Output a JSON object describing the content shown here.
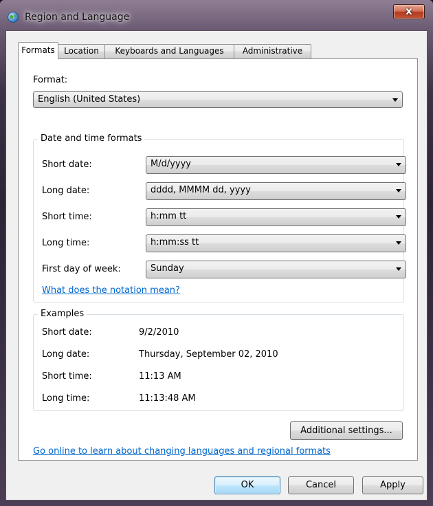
{
  "window": {
    "title": "Region and Language",
    "close_glyph": "x",
    "icon": "globe-icon"
  },
  "tabs": [
    {
      "label": "Formats",
      "active": true
    },
    {
      "label": "Location",
      "active": false
    },
    {
      "label": "Keyboards and Languages",
      "active": false
    },
    {
      "label": "Administrative",
      "active": false
    }
  ],
  "format": {
    "label": "Format:",
    "selected": "English (United States)"
  },
  "date_time_formats": {
    "title": "Date and time formats",
    "rows": [
      {
        "label": "Short date:",
        "value": "M/d/yyyy"
      },
      {
        "label": "Long date:",
        "value": "dddd, MMMM dd, yyyy"
      },
      {
        "label": "Short time:",
        "value": "h:mm tt"
      },
      {
        "label": "Long time:",
        "value": "h:mm:ss tt"
      },
      {
        "label": "First day of week:",
        "value": "Sunday"
      }
    ],
    "notation_link": "What does the notation mean?"
  },
  "examples": {
    "title": "Examples",
    "rows": [
      {
        "label": "Short date:",
        "value": "9/2/2010"
      },
      {
        "label": "Long date:",
        "value": "Thursday, September 02, 2010"
      },
      {
        "label": "Short time:",
        "value": "11:13 AM"
      },
      {
        "label": "Long time:",
        "value": "11:13:48 AM"
      }
    ]
  },
  "additional_settings_label": "Additional settings...",
  "online_link": "Go online to learn about changing languages and regional formats",
  "buttons": {
    "ok": "OK",
    "cancel": "Cancel",
    "apply": "Apply"
  },
  "colors": {
    "link": "#0066cc",
    "close_button": "#c4553a",
    "default_button_border": "#3c7fb1"
  }
}
